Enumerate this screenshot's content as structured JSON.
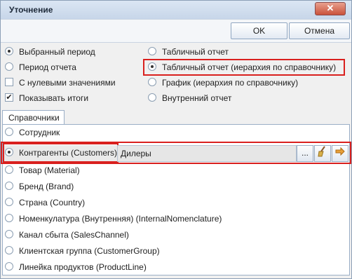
{
  "window": {
    "title": "Уточнение",
    "close_symbol": "✕"
  },
  "toolbar": {
    "ok_label": "OK",
    "cancel_label": "Отмена"
  },
  "left_options": [
    {
      "label": "Выбранный период",
      "type": "radio",
      "checked": true
    },
    {
      "label": "Период отчета",
      "type": "radio",
      "checked": false
    },
    {
      "label": "С нулевыми значениями",
      "type": "checkbox",
      "checked": false
    },
    {
      "label": "Показывать итоги",
      "type": "checkbox",
      "checked": true
    }
  ],
  "right_options": [
    {
      "label": "Табличный отчет",
      "checked": false
    },
    {
      "label": "Табличный отчет (иерархия по справочнику)",
      "checked": true
    },
    {
      "label": "График (иерархия по справочнику)",
      "checked": false
    },
    {
      "label": "Внутренний отчет",
      "checked": false
    }
  ],
  "tab": {
    "label": "Справочники"
  },
  "reference_items": [
    {
      "label": "Сотрудник",
      "checked": false
    },
    {
      "label": "Контрагенты (Customers)",
      "checked": true,
      "value": "Дилеры"
    },
    {
      "label": "Товар  (Material)",
      "checked": false
    },
    {
      "label": "Бренд (Brand)",
      "checked": false
    },
    {
      "label": "Страна (Country)",
      "checked": false
    },
    {
      "label": "Номенкулатура (Внутренняя) (InternalNomenclature)",
      "checked": false
    },
    {
      "label": "Канал сбыта (SalesChannel)",
      "checked": false
    },
    {
      "label": "Клиентская группа (CustomerGroup)",
      "checked": false
    },
    {
      "label": "Линейка продуктов (ProductLine)",
      "checked": false
    }
  ],
  "row_buttons": {
    "browse_label": "...",
    "clear_icon": "broom-icon",
    "apply_icon": "arrow-icon"
  },
  "colors": {
    "highlight": "#d9201e",
    "titlebar": "#c7d6e9",
    "close_button": "#c9523b"
  }
}
